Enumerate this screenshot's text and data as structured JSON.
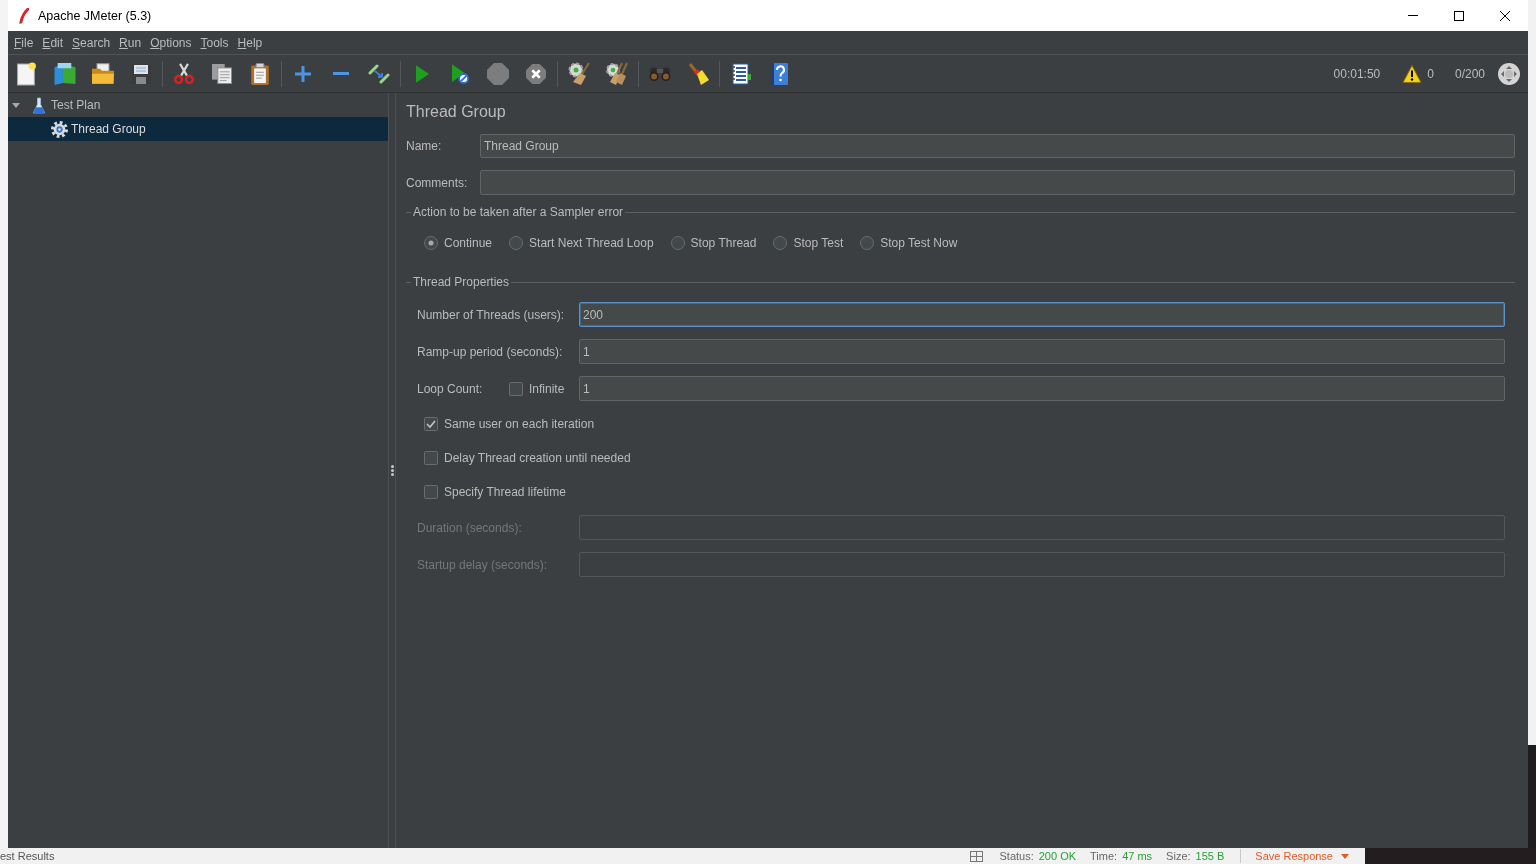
{
  "window": {
    "title": "Apache JMeter (5.3)"
  },
  "menu_bar": [
    "File",
    "Edit",
    "Search",
    "Run",
    "Options",
    "Tools",
    "Help"
  ],
  "toolbar": {
    "groups": [
      {
        "tools": [
          {
            "kind": "new",
            "disabled": false
          },
          {
            "kind": "templates",
            "disabled": false
          },
          {
            "kind": "open",
            "disabled": false
          },
          {
            "kind": "save",
            "disabled": false
          }
        ]
      },
      {
        "tools": [
          {
            "kind": "cut",
            "disabled": false
          },
          {
            "kind": "copy",
            "disabled": false
          },
          {
            "kind": "paste",
            "disabled": false
          }
        ]
      },
      {
        "tools": [
          {
            "kind": "expand",
            "disabled": false
          },
          {
            "kind": "collapse",
            "disabled": false
          },
          {
            "kind": "toggle",
            "disabled": false
          }
        ]
      },
      {
        "tools": [
          {
            "kind": "start",
            "disabled": false
          },
          {
            "kind": "start_no_pauses",
            "disabled": false
          },
          {
            "kind": "stop",
            "disabled": true
          },
          {
            "kind": "shutdown",
            "disabled": true
          }
        ]
      },
      {
        "tools": [
          {
            "kind": "clear",
            "disabled": false
          },
          {
            "kind": "clear_all",
            "disabled": false
          }
        ]
      },
      {
        "tools": [
          {
            "kind": "search",
            "disabled": false
          },
          {
            "kind": "reset_search",
            "disabled": false
          }
        ]
      },
      {
        "tools": [
          {
            "kind": "function_helper",
            "disabled": false
          },
          {
            "kind": "help",
            "disabled": false
          }
        ]
      }
    ],
    "elapsed_time": "00:01:50",
    "warning_count": "0",
    "active_threads": "0/200"
  },
  "tree": [
    {
      "kind": "plan",
      "label": "Test Plan",
      "expanded": true,
      "selected": false,
      "children": [
        {
          "kind": "thread_group",
          "label": "Thread Group",
          "selected": true
        }
      ]
    }
  ],
  "editor": {
    "title": "Thread Group",
    "fields": [
      {
        "label": "Name:",
        "value": "Thread Group"
      },
      {
        "label": "Comments:"
      }
    ],
    "sampler_error": {
      "legend": "Action to be taken after a Sampler error",
      "options": [
        {
          "label": "Continue",
          "selected": true
        },
        {
          "label": "Start Next Thread Loop",
          "selected": false
        },
        {
          "label": "Stop Thread",
          "selected": false
        },
        {
          "label": "Stop Test",
          "selected": false
        },
        {
          "label": "Stop Test Now",
          "selected": false
        }
      ]
    },
    "thread_properties": {
      "legend": "Thread Properties",
      "rows": [
        {
          "kind": "field",
          "label": "Number of Threads (users):",
          "value": "200",
          "focused": true,
          "disabled": false
        },
        {
          "kind": "field",
          "label": "Ramp-up period (seconds):",
          "value": "1",
          "focused": false,
          "disabled": false
        },
        {
          "kind": "loop",
          "label": "Loop Count:",
          "infinite": {
            "label": "Infinite",
            "checked": false
          },
          "value": "1"
        },
        {
          "kind": "check",
          "label": "Same user on each iteration",
          "checked": true
        },
        {
          "kind": "check",
          "label": "Delay Thread creation until needed",
          "checked": false
        },
        {
          "kind": "check",
          "label": "Specify Thread lifetime",
          "checked": false
        },
        {
          "kind": "field",
          "label": "Duration (seconds):",
          "focused": false,
          "disabled": true
        },
        {
          "kind": "field",
          "label": "Startup delay (seconds):",
          "focused": false,
          "disabled": true
        }
      ]
    }
  },
  "background_window": {
    "tab_title": "est Results",
    "status_label": "Status:",
    "status_value": "200 OK",
    "time_label": "Time:",
    "time_value": "47 ms",
    "size_label": "Size:",
    "size_value": "155 B",
    "save_response": "Save Response"
  }
}
